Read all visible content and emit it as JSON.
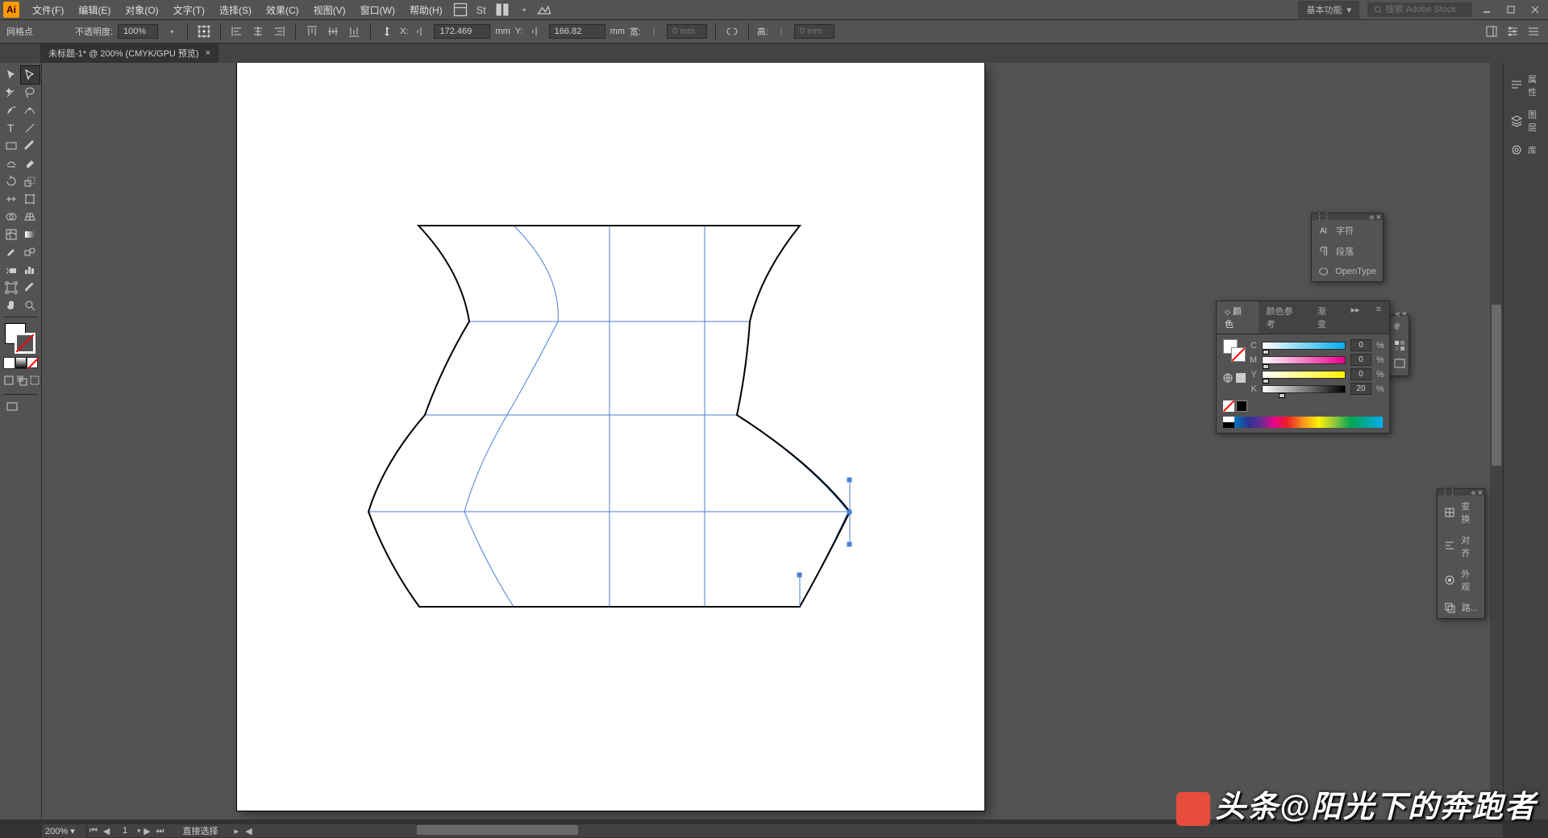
{
  "menubar": {
    "logo": "Ai",
    "items": [
      "文件(F)",
      "编辑(E)",
      "对象(O)",
      "文字(T)",
      "选择(S)",
      "效果(C)",
      "视图(V)",
      "窗口(W)",
      "帮助(H)"
    ],
    "workspace": "基本功能",
    "search_placeholder": "搜索 Adobe Stock"
  },
  "controlbar": {
    "selection_label": "网格点",
    "opacity_label": "不透明度:",
    "opacity_value": "100%",
    "x_label": "X:",
    "x_value": "172.469",
    "y_label": "Y:",
    "y_value": "166.82",
    "unit": "mm",
    "width_label": "宽:",
    "width_value": "0 mm",
    "height_label": "高:",
    "height_value": "0 mm"
  },
  "tab": {
    "title": "未标题-1* @ 200% (CMYK/GPU 预览)",
    "close": "×"
  },
  "right_dock": {
    "items": [
      "属性",
      "图层",
      "库"
    ]
  },
  "type_panel": {
    "items": [
      "字符",
      "段落",
      "OpenType"
    ]
  },
  "color_panel": {
    "tabs": [
      "颜色",
      "颜色参考",
      "渐变"
    ],
    "c": {
      "label": "C",
      "value": "0"
    },
    "m": {
      "label": "M",
      "value": "0"
    },
    "y": {
      "label": "Y",
      "value": "0"
    },
    "k": {
      "label": "K",
      "value": "20"
    },
    "pct": "%"
  },
  "trans_panel": {
    "items": [
      "变换",
      "对齐",
      "外观",
      "路..."
    ]
  },
  "status": {
    "zoom": "200%",
    "page": "1",
    "tool": "直接选择"
  },
  "watermark": "头条@阳光下的奔跑者"
}
